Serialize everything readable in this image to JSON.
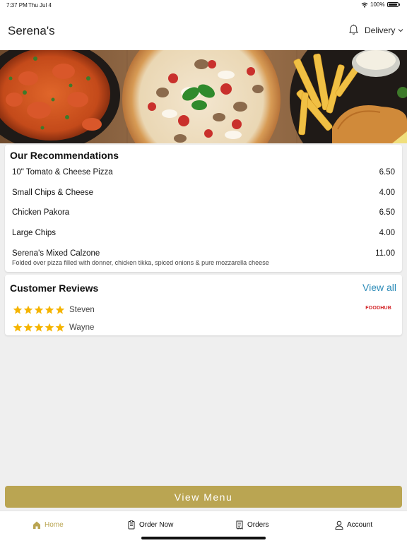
{
  "status_bar": {
    "time": "7:37 PM",
    "date": "Thu Jul 4",
    "battery": "100%"
  },
  "header": {
    "title": "Serena's",
    "mode_label": "Delivery"
  },
  "recommendations": {
    "title": "Our Recommendations",
    "items": [
      {
        "name": "10\" Tomato & Cheese Pizza",
        "price": "6.50",
        "description": ""
      },
      {
        "name": "Small Chips & Cheese",
        "price": "4.00",
        "description": ""
      },
      {
        "name": "Chicken Pakora",
        "price": "6.50",
        "description": ""
      },
      {
        "name": "Large Chips",
        "price": "4.00",
        "description": ""
      },
      {
        "name": "Serena's Mixed Calzone",
        "price": "11.00",
        "description": "Folded over pizza filled with donner, chicken tikka, spiced onions & pure mozzarella cheese"
      }
    ]
  },
  "reviews": {
    "title": "Customer Reviews",
    "view_all_label": "View all",
    "source_badge": "FOODHUB",
    "items": [
      {
        "name": "Steven",
        "stars": 5
      },
      {
        "name": "Wayne",
        "stars": 5
      }
    ]
  },
  "view_menu_label": "View Menu",
  "tabs": [
    {
      "label": "Home",
      "icon": "home-icon",
      "active": true
    },
    {
      "label": "Order Now",
      "icon": "order-icon",
      "active": false
    },
    {
      "label": "Orders",
      "icon": "receipt-icon",
      "active": false
    },
    {
      "label": "Account",
      "icon": "user-icon",
      "active": false
    }
  ],
  "colors": {
    "accent": "#baa552",
    "link": "#2e8cb8",
    "star": "#f5b400",
    "brand_red": "#d32327"
  }
}
